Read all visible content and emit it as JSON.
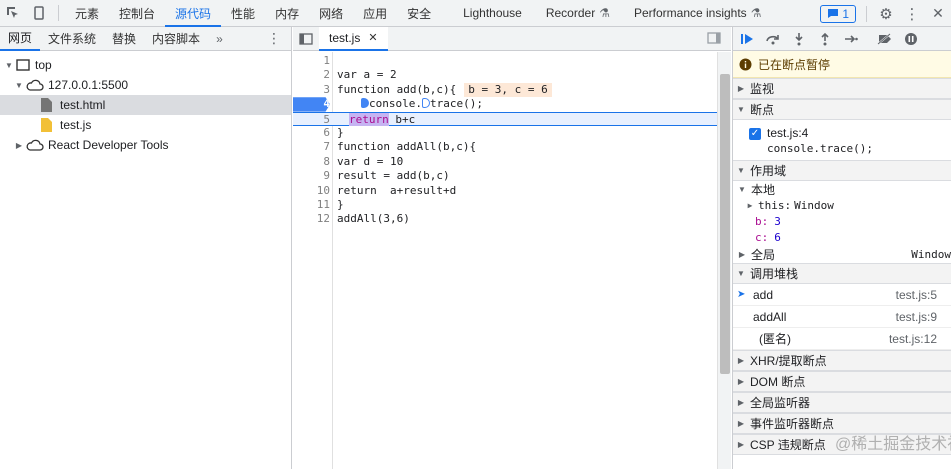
{
  "topbar": {
    "tabs": [
      "元素",
      "控制台",
      "源代码",
      "性能",
      "内存",
      "网络",
      "应用",
      "安全",
      "Lighthouse",
      "Recorder",
      "Performance insights"
    ],
    "active_tab": "源代码",
    "issues_count": "1"
  },
  "navigator": {
    "tabs": [
      "网页",
      "文件系统",
      "替换",
      "内容脚本"
    ],
    "more": "»",
    "tree": {
      "top": "top",
      "origin": "127.0.0.1:5500",
      "file_html": "test.html",
      "file_js": "test.js",
      "extension": "React Developer Tools"
    }
  },
  "editor": {
    "file_tab": "test.js",
    "lines": {
      "l1": {
        "num": "1"
      },
      "l2": {
        "num": "2",
        "code": "var a = 2"
      },
      "l3": {
        "num": "3",
        "pre": "function add(b,c){",
        "inline": "b = 3, c = 6"
      },
      "l4": {
        "num": "4",
        "a": "console.",
        "b": "trace();"
      },
      "l5": {
        "num": "5",
        "kw": "return",
        "rest": " b+c"
      },
      "l6": {
        "num": "6",
        "code": "}"
      },
      "l7": {
        "num": "7",
        "code": "function addAll(b,c){"
      },
      "l8": {
        "num": "8",
        "code": "var d = 10"
      },
      "l9": {
        "num": "9",
        "code": "result = add(b,c)"
      },
      "l10": {
        "num": "10",
        "code": "return  a+result+d"
      },
      "l11": {
        "num": "11",
        "code": "}"
      },
      "l12": {
        "num": "12",
        "code": "addAll(3,6)"
      }
    }
  },
  "debugger": {
    "paused_text": "已在断点暂停",
    "sections": {
      "watch": "监视",
      "breakpoints": "断点",
      "scope": "作用域",
      "callstack": "调用堆栈",
      "xhr": "XHR/提取断点",
      "dom": "DOM 断点",
      "global_listeners": "全局监听器",
      "event_listeners": "事件监听器断点",
      "csp": "CSP 违规断点"
    },
    "breakpoint": {
      "location": "test.js:4",
      "code": "console.trace();"
    },
    "scope": {
      "local": "本地",
      "this_label": "this:",
      "this_value": "Window",
      "b_label": "b:",
      "b_value": "3",
      "c_label": "c:",
      "c_value": "6",
      "global": "全局",
      "global_value": "Window"
    },
    "callstack": [
      {
        "fn": "add",
        "loc": "test.js:5"
      },
      {
        "fn": "addAll",
        "loc": "test.js:9"
      },
      {
        "fn": "(匿名)",
        "loc": "test.js:12"
      }
    ]
  },
  "watermark": "@稀土掘金技术社区",
  "colors": {
    "accent": "#1a73e8",
    "keyword": "#aa0d91",
    "paused_bg": "#fffbe5",
    "inline_value_bg": "#fde8d7"
  }
}
